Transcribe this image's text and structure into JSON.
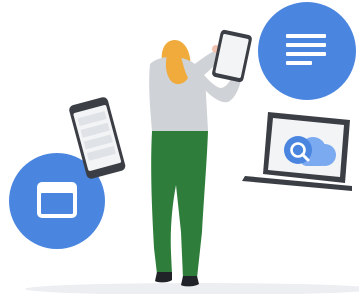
{
  "illustration": {
    "subject": "person-holding-tablet",
    "icons": [
      "document-icon",
      "browser-window-icon",
      "cloud-search-icon"
    ],
    "devices": [
      "tablet",
      "smartphone",
      "laptop"
    ],
    "colors": {
      "accent_blue": "#4a86e0",
      "light_blue": "#7baaf0",
      "hair": "#f0ab3c",
      "sweater": "#cfd2d6",
      "pants": "#2f7d3a",
      "device_dark": "#3b3f45",
      "screen_light": "#f3f4f6",
      "skin": "#f2c2b1",
      "floor_shadow": "#e8e9eb"
    }
  }
}
